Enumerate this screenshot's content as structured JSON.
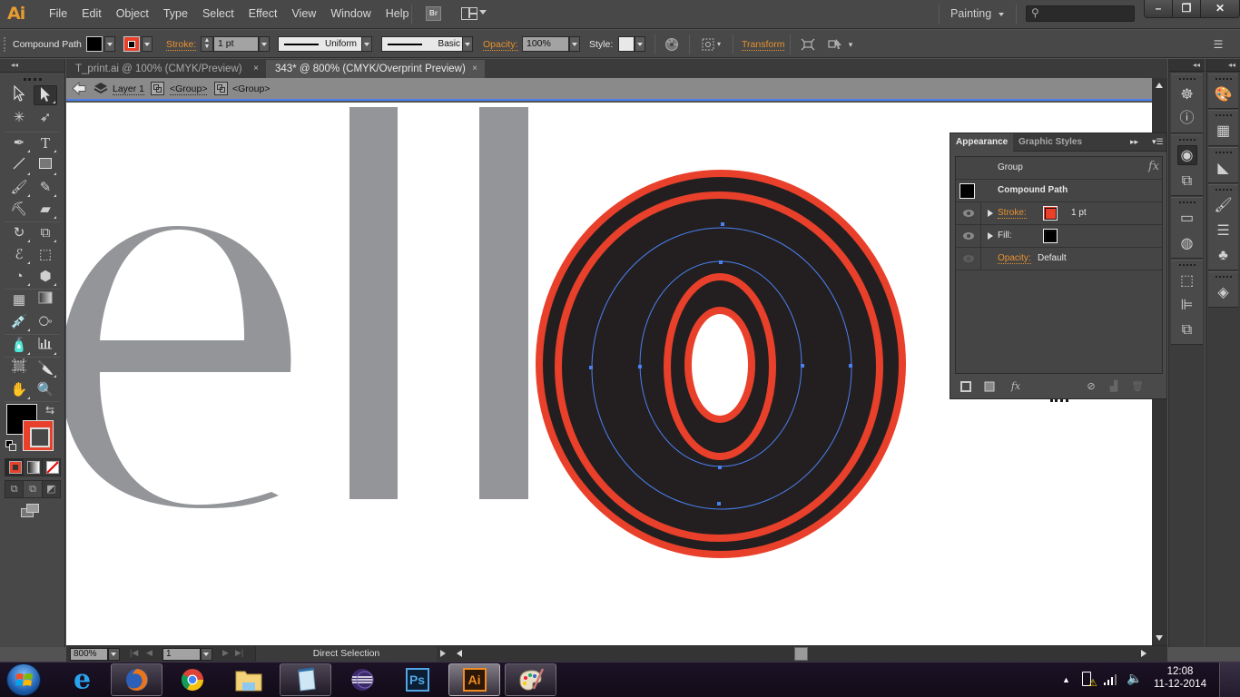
{
  "app": {
    "logo": "Ai",
    "menu": [
      "File",
      "Edit",
      "Object",
      "Type",
      "Select",
      "Effect",
      "View",
      "Window",
      "Help"
    ],
    "bridge_label": "Br",
    "workspace": "Painting",
    "search_placeholder": "",
    "window_controls": {
      "minimize": "–",
      "restore": "❐",
      "close": "✕"
    }
  },
  "control_bar": {
    "selection_type": "Compound Path",
    "fill_color": "#000000",
    "stroke_color": "#e8402a",
    "stroke_label": "Stroke:",
    "stroke_weight": "1 pt",
    "variable_width_profile": "Uniform",
    "brush_definition": "Basic",
    "opacity_label": "Opacity:",
    "opacity_value": "100%",
    "style_label": "Style:",
    "transform_label": "Transform"
  },
  "document_tabs": [
    {
      "label": "T_print.ai @ 100% (CMYK/Preview)",
      "active": false,
      "close": "×"
    },
    {
      "label": "343* @ 800% (CMYK/Overprint Preview)",
      "active": true,
      "close": "×"
    }
  ],
  "breadcrumb": {
    "items": [
      "Layer 1",
      "<Group>",
      "<Group>"
    ]
  },
  "canvas": {
    "letters_visible": "ello",
    "letter_color": "#939598",
    "selected_fill": "#231f20",
    "selected_stroke": "#e8402a",
    "path_highlight_color": "#4a80f0"
  },
  "status_bar": {
    "zoom": "800%",
    "artboard": "1",
    "current_tool": "Direct Selection"
  },
  "appearance_panel": {
    "tabs": [
      {
        "label": "Appearance",
        "active": true
      },
      {
        "label": "Graphic Styles",
        "active": false
      }
    ],
    "group_label": "Group",
    "fx_label": "fx",
    "object_label": "Compound Path",
    "rows": [
      {
        "name": "Stroke:",
        "color": "#e8402a",
        "value": "1 pt",
        "link": true,
        "visible": true
      },
      {
        "name": "Fill:",
        "color": "#000000",
        "value": "",
        "link": false,
        "visible": true
      },
      {
        "name": "Opacity:",
        "value": "Default",
        "link": true,
        "visible": false
      }
    ],
    "footer_fx": "fx"
  },
  "taskbar": {
    "apps": [
      {
        "name": "Internet Explorer",
        "state": "pinned"
      },
      {
        "name": "Firefox",
        "state": "open"
      },
      {
        "name": "Chrome",
        "state": "pinned"
      },
      {
        "name": "Windows Explorer",
        "state": "pinned"
      },
      {
        "name": "Notepad",
        "state": "open"
      },
      {
        "name": "Eclipse",
        "state": "pinned"
      },
      {
        "name": "Photoshop",
        "state": "pinned",
        "label": "Ps"
      },
      {
        "name": "Illustrator",
        "state": "current",
        "label": "Ai"
      },
      {
        "name": "Paint",
        "state": "open"
      }
    ],
    "time": "12:08",
    "date": "11-12-2014"
  }
}
